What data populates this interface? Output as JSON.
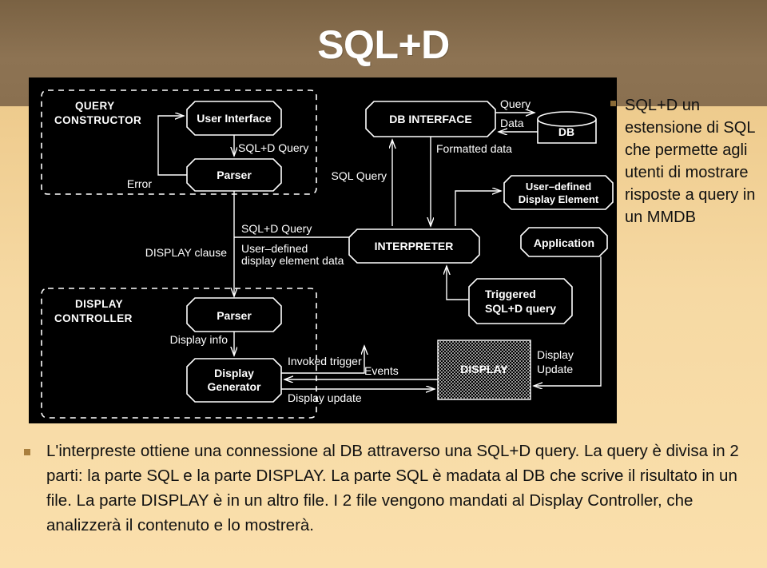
{
  "slide": {
    "title": "SQL+D",
    "colors": {
      "band_top": "#8a7050",
      "band_bottom": "#f7d9a4",
      "title_color": "#ffffff",
      "bullet_color": "#8a6a36",
      "diagram_bg": "#000000",
      "diagram_stroke": "#ffffff"
    }
  },
  "sidebar": {
    "bullet": "square-bullet",
    "text": "SQL+D un estensione di SQL che permette agli utenti di mostrare risposte a query in un MMDB"
  },
  "body": {
    "bullet": "square-bullet",
    "text": "L'interpreste ottiene una connessione al DB attraverso una SQL+D query. La query è divisa in 2 parti: la parte SQL e la parte DISPLAY. La parte SQL è madata al DB che scrive il risultato in un file. La parte DISPLAY è in un altro file. I 2 file vengono mandati al Display Controller, che analizzerà il contenuto e lo mostrerà."
  },
  "diagram": {
    "name": "sqld-architecture-diagram",
    "groups": [
      {
        "id": "query-constructor",
        "label_line1": "QUERY",
        "label_line2": "CONSTRUCTOR"
      },
      {
        "id": "display-controller",
        "label_line1": "DISPLAY",
        "label_line2": "CONTROLLER"
      }
    ],
    "boxes": [
      {
        "id": "user-interface",
        "label": "User Interface"
      },
      {
        "id": "parser-query",
        "label": "Parser"
      },
      {
        "id": "parser-display",
        "label": "Parser"
      },
      {
        "id": "display-generator",
        "label_line1": "Display",
        "label_line2": "Generator"
      },
      {
        "id": "db-interface",
        "label": "DB INTERFACE"
      },
      {
        "id": "db",
        "label": "DB"
      },
      {
        "id": "interpreter",
        "label": "INTERPRETER"
      },
      {
        "id": "user-defined-display-element",
        "label_line1": "User–defined",
        "label_line2": "Display Element"
      },
      {
        "id": "application",
        "label": "Application"
      },
      {
        "id": "triggered-sqld-query",
        "label_line1": "Triggered",
        "label_line2": "SQL+D query"
      },
      {
        "id": "display",
        "label": "DISPLAY"
      }
    ],
    "edge_labels": [
      {
        "id": "sqld-query-1",
        "text": "SQL+D Query"
      },
      {
        "id": "error",
        "text": "Error"
      },
      {
        "id": "sqld-query-2",
        "text": "SQL+D Query"
      },
      {
        "id": "display-clause",
        "text": "DISPLAY clause"
      },
      {
        "id": "user-defined-display-element-data-1",
        "text": "User–defined"
      },
      {
        "id": "user-defined-display-element-data-2",
        "text": "display element data"
      },
      {
        "id": "display-info",
        "text": "Display info"
      },
      {
        "id": "invoked-trigger",
        "text": "Invoked trigger"
      },
      {
        "id": "display-update",
        "text": "Display update"
      },
      {
        "id": "query",
        "text": "Query"
      },
      {
        "id": "data",
        "text": "Data"
      },
      {
        "id": "formatted-data",
        "text": "Formatted data"
      },
      {
        "id": "sql-query",
        "text": "SQL Query"
      },
      {
        "id": "events",
        "text": "Events"
      },
      {
        "id": "display-update-right-1",
        "text": "Display"
      },
      {
        "id": "display-update-right-2",
        "text": "Update"
      }
    ]
  }
}
